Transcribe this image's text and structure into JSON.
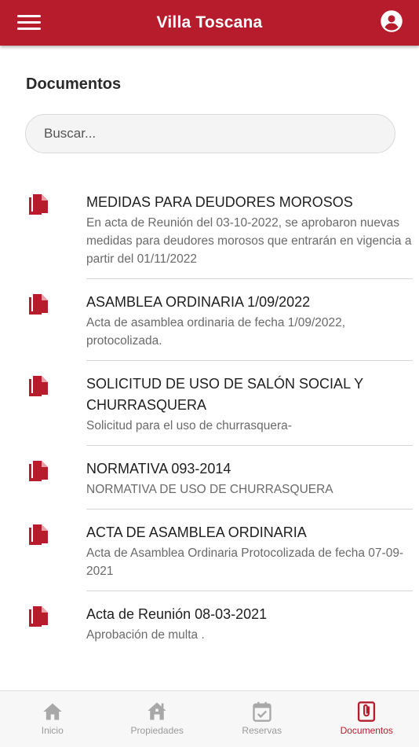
{
  "header": {
    "title": "Villa Toscana",
    "menu_icon": "hamburger-menu-icon",
    "account_icon": "account-circle-icon"
  },
  "page": {
    "heading": "Documentos"
  },
  "search": {
    "placeholder": "Buscar..."
  },
  "colors": {
    "brand": "#b71c2c",
    "inactive": "#9a9a9a"
  },
  "documents": [
    {
      "title": "MEDIDAS PARA DEUDORES MOROSOS",
      "description": "En acta de Reunión del 03-10-2022, se aprobaron nuevas medidas para deudores morosos que entrarán en vigencia a partir del 01/11/2022",
      "icon": "file-copy-icon"
    },
    {
      "title": "ASAMBLEA ORDINARIA 1/09/2022",
      "description": "Acta de asamblea ordinaria de fecha 1/09/2022, protocolizada.",
      "icon": "file-copy-icon"
    },
    {
      "title": "SOLICITUD DE USO DE SALÓN SOCIAL Y CHURRASQUERA",
      "description": "Solicitud para el uso de churrasquera-",
      "icon": "file-copy-icon"
    },
    {
      "title": "NORMATIVA 093-2014",
      "description": "NORMATIVA DE USO DE CHURRASQUERA",
      "icon": "file-copy-icon"
    },
    {
      "title": "ACTA DE ASAMBLEA ORDINARIA",
      "description": "Acta de Asamblea Ordinaria Protocolizada de fecha 07-09-2021",
      "icon": "file-copy-icon"
    },
    {
      "title": "Acta de Reunión 08-03-2021",
      "description": "Aprobación de multa .",
      "icon": "file-copy-icon"
    }
  ],
  "bottom_nav": [
    {
      "label": "Inicio",
      "icon": "home-icon",
      "active": false
    },
    {
      "label": "Propiedades",
      "icon": "houses-icon",
      "active": false
    },
    {
      "label": "Reservas",
      "icon": "calendar-check-icon",
      "active": false
    },
    {
      "label": "Documentos",
      "icon": "attachment-document-icon",
      "active": true
    }
  ]
}
